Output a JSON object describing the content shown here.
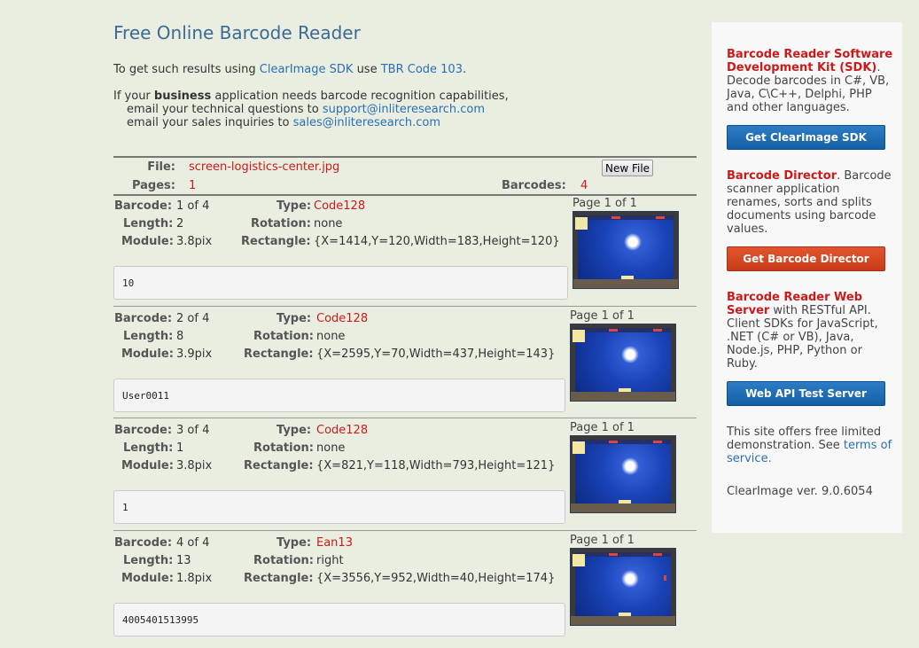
{
  "page": {
    "title": "Free Online Barcode Reader",
    "intro": {
      "line1_prefix": "To get such results using",
      "sdk_link": "ClearImage SDK",
      "line1_mid": "use",
      "tbr_link": "TBR Code 103",
      "line1_suffix": ".",
      "line2_prefix": "If your",
      "line2_bold": "business",
      "line2_suffix": "application needs barcode recognition capabilities,",
      "tech_prefix": "email your technical questions to",
      "tech_email": "support@inliteresearch.com",
      "sales_prefix": "email your sales inquiries to",
      "sales_email": "sales@inliteresearch.com"
    }
  },
  "file_bar": {
    "file_label": "File:",
    "file_name": "screen-logistics-center.jpg",
    "new_file_button": "New File",
    "pages_label": "Pages:",
    "pages_value": "1",
    "barcodes_label": "Barcodes:",
    "barcodes_value": "4"
  },
  "labels": {
    "barcode": "Barcode:",
    "length": "Length:",
    "module": "Module:",
    "type": "Type:",
    "rotation": "Rotation:",
    "rectangle": "Rectangle:"
  },
  "results": [
    {
      "barcode": "1 of 4",
      "length": "2",
      "module": "3.8pix",
      "type": "Code128",
      "rotation": "none",
      "rectangle": "{X=1414,Y=120,Width=183,Height=120}",
      "value": "10",
      "page_label": "Page 1 of 1"
    },
    {
      "barcode": "2 of 4",
      "length": "8",
      "module": "3.9pix",
      "type": "Code128",
      "rotation": "none",
      "rectangle": "{X=2595,Y=70,Width=437,Height=143}",
      "value": "User0011",
      "page_label": "Page 1 of 1"
    },
    {
      "barcode": "3 of 4",
      "length": "1",
      "module": "3.8pix",
      "type": "Code128",
      "rotation": "none",
      "rectangle": "{X=821,Y=118,Width=793,Height=121}",
      "value": "1",
      "page_label": "Page 1 of 1"
    },
    {
      "barcode": "4 of 4",
      "length": "13",
      "module": "1.8pix",
      "type": "Ean13",
      "rotation": "right",
      "rectangle": "{X=3556,Y=952,Width=40,Height=174}",
      "value": "4005401513995",
      "page_label": "Page 1 of 1"
    }
  ],
  "sidebar": {
    "sdk_title": "Barcode Reader Software Development Kit (SDK)",
    "sdk_desc": ". Decode barcodes in C#, VB, Java, C\\C++, Delphi, PHP and other languages.",
    "sdk_button": "Get ClearImage SDK",
    "director_title": "Barcode Director",
    "director_desc": ". Barcode scanner application renames, sorts and splits documents using barcode values.",
    "director_button": "Get Barcode Director",
    "web_title": "Barcode Reader Web Server",
    "web_desc": " with RESTful API. Client SDKs for JavaScript, .NET (C# or VB), Java, Node.js, PHP, Python or Ruby.",
    "web_button": "Web API Test Server",
    "offer_text": "This site offers free limited demonstration. See",
    "terms_link": "terms of service.",
    "version": "ClearImage ver. 9.0.6054"
  },
  "colors": {
    "accent_red": "#cc1a1a",
    "link_blue": "#2a6fb5",
    "button_blue": "#1a6db8",
    "button_orange": "#d44a22",
    "background": "#eaeee1"
  }
}
